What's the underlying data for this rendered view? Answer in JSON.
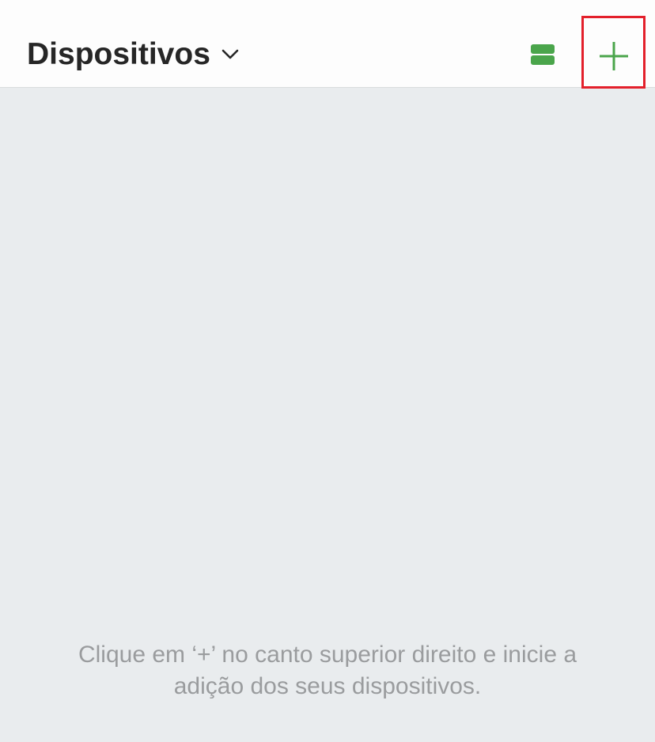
{
  "header": {
    "title": "Dispositivos",
    "title_dropdown_icon": "chevron-down-icon",
    "view_toggle_icon": "list-view-icon",
    "add_icon": "plus-icon"
  },
  "main": {
    "empty_message_line1": "Clique em ‘+’ no canto superior direito e inicie a",
    "empty_message_line2": "adição dos seus dispositivos."
  },
  "colors": {
    "accent": "#4aa54b",
    "highlight_border": "#e3202b",
    "background": "#e9ecee",
    "header_background": "#fdfdfd"
  }
}
